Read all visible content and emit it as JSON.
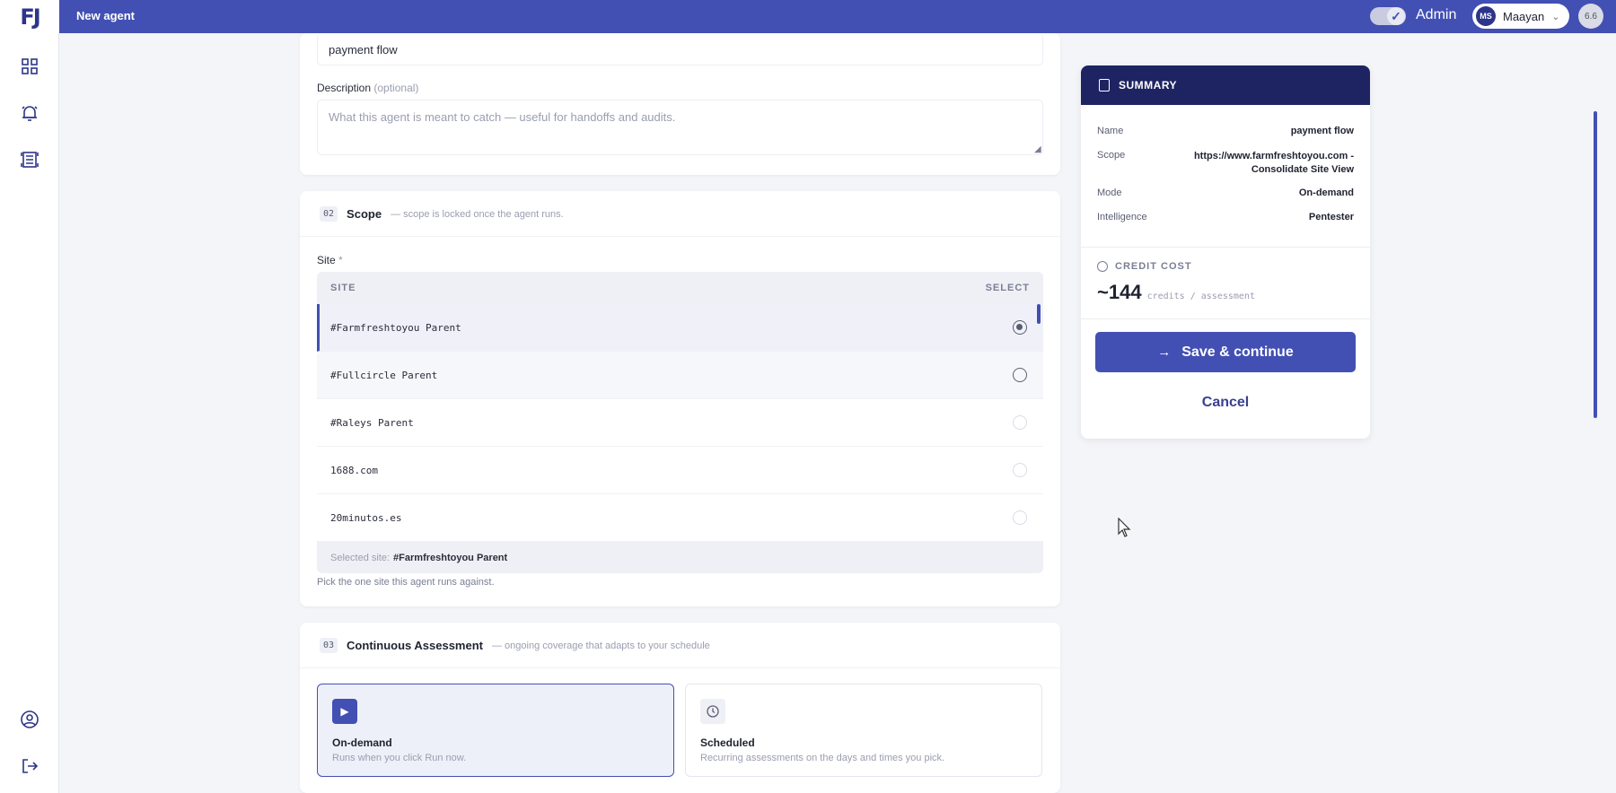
{
  "topbar": {
    "logo": "FJ",
    "page_title": "New agent",
    "role": "Admin",
    "user_initials": "MS",
    "user_name": "Maayan",
    "corner_avatar": "6.6"
  },
  "sidebar": {
    "items": [
      {
        "icon": "dashboard-grid-icon"
      },
      {
        "icon": "alarm-bell-icon"
      },
      {
        "icon": "report-list-icon"
      },
      {
        "icon": "user-circle-icon"
      },
      {
        "icon": "logout-icon"
      }
    ]
  },
  "form": {
    "name_value": "payment flow",
    "description_label": "Description",
    "description_optional": "(optional)",
    "description_placeholder": "What this agent is meant to catch — useful for handoffs and audits."
  },
  "scope": {
    "num": "02",
    "title": "Scope",
    "subtitle": "— scope is locked once the agent runs.",
    "site_label": "Site",
    "required_mark": "*",
    "col_site": "SITE",
    "col_select": "SELECT",
    "sites": [
      {
        "name": "#Farmfreshtoyou Parent",
        "selected": true
      },
      {
        "name": "#Fullcircle Parent",
        "selected": false
      },
      {
        "name": "#Raleys Parent",
        "selected": false
      },
      {
        "name": "1688.com",
        "selected": false
      },
      {
        "name": "20minutos.es",
        "selected": false
      }
    ],
    "selected_prefix": "Selected site:",
    "selected_value": "#Farmfreshtoyou Parent",
    "hint": "Pick the one site this agent runs against."
  },
  "assessment": {
    "num": "03",
    "title": "Continuous Assessment",
    "subtitle": "— ongoing coverage that adapts to your schedule",
    "modes": [
      {
        "title": "On-demand",
        "desc": "Runs when you click Run now.",
        "icon": "play-icon",
        "active": true
      },
      {
        "title": "Scheduled",
        "desc": "Recurring assessments on the days and times you pick.",
        "icon": "clock-icon",
        "active": false
      }
    ]
  },
  "summary": {
    "header": "SUMMARY",
    "rows": [
      {
        "key": "Name",
        "value": "payment flow"
      },
      {
        "key": "Scope",
        "value": "https://www.farmfreshtoyou.com - Consolidate Site View"
      },
      {
        "key": "Mode",
        "value": "On-demand"
      },
      {
        "key": "Intelligence",
        "value": "Pentester"
      }
    ],
    "credit_label": "CREDIT COST",
    "credit_value": "~144",
    "credit_unit": "credits / assessment",
    "save_label": "Save & continue",
    "cancel_label": "Cancel"
  },
  "colors": {
    "brand": "#4250b3",
    "summary_header": "#1e2462",
    "background": "#f4f5f8"
  }
}
